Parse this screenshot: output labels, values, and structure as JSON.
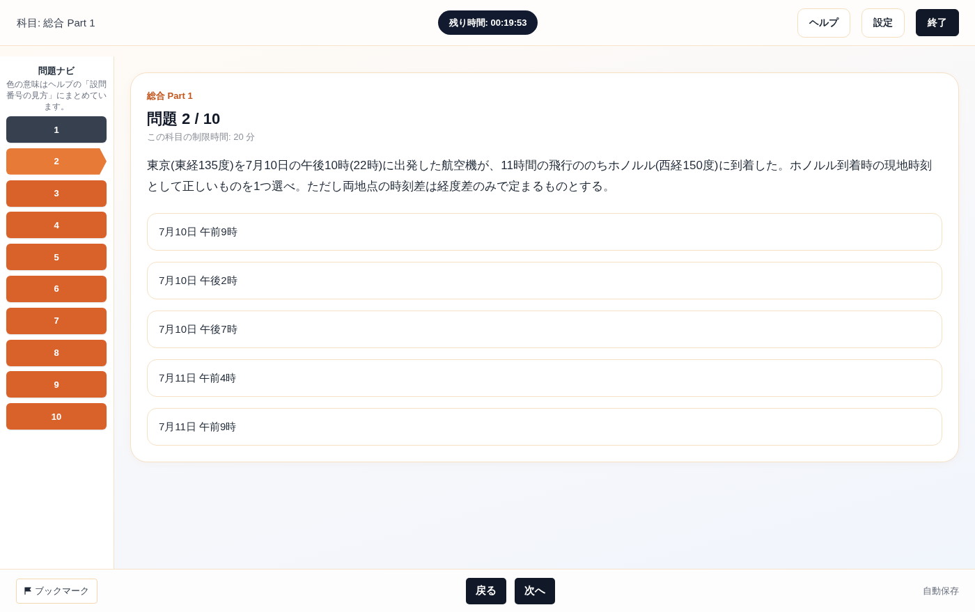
{
  "header": {
    "subject": "科目: 総合 Part 1",
    "timer": "残り時間: 00:19:53",
    "buttons": [
      {
        "label": "ヘルプ",
        "kind": "outline"
      },
      {
        "label": "設定",
        "kind": "outline"
      },
      {
        "label": "終了",
        "kind": "primary"
      }
    ]
  },
  "nav": {
    "title": "問題ナビ",
    "note": "色の意味はヘルプの「設問番号の見方」にまとめています。",
    "items": [
      {
        "label": "1",
        "color": "#36404f",
        "selected": false
      },
      {
        "label": "2",
        "color": "#e87a37",
        "selected": true
      },
      {
        "label": "3",
        "color": "#d9622b",
        "selected": false
      },
      {
        "label": "4",
        "color": "#d9622b",
        "selected": false
      },
      {
        "label": "5",
        "color": "#d9622b",
        "selected": false
      },
      {
        "label": "6",
        "color": "#d9622b",
        "selected": false
      },
      {
        "label": "7",
        "color": "#d9622b",
        "selected": false
      },
      {
        "label": "8",
        "color": "#d9622b",
        "selected": false
      },
      {
        "label": "9",
        "color": "#d9622b",
        "selected": false
      },
      {
        "label": "10",
        "color": "#d9622b",
        "selected": false
      }
    ]
  },
  "question": {
    "section": "総合 Part 1",
    "title": "問題 2 / 10",
    "time_limit": "この科目の制限時間: 20 分",
    "text": "東京(東経135度)を7月10日の午後10時(22時)に出発した航空機が、11時間の飛行ののちホノルル(西経150度)に到着した。ホノルル到着時の現地時刻として正しいものを1つ選べ。ただし両地点の時刻差は経度差のみで定まるものとする。",
    "choices": [
      {
        "label": "7月10日 午前9時",
        "selected": false
      },
      {
        "label": "7月10日 午後2時",
        "selected": false
      },
      {
        "label": "7月10日 午後7時",
        "selected": false
      },
      {
        "label": "7月11日 午前4時",
        "selected": false
      },
      {
        "label": "7月11日 午前9時",
        "selected": false
      }
    ]
  },
  "footer": {
    "bookmark": "ブックマーク",
    "nav_buttons": [
      "戻る",
      "次へ"
    ],
    "autosave": "自動保存"
  }
}
